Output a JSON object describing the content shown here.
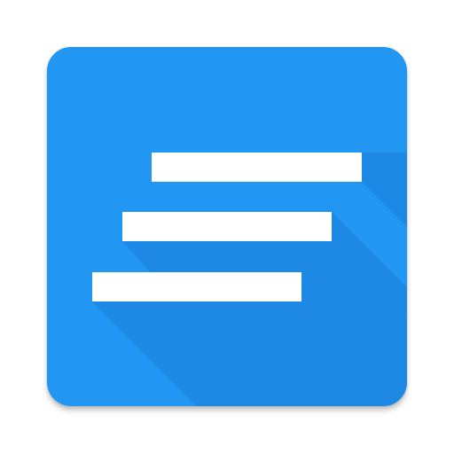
{
  "app_icon": {
    "icon": "lines-icon",
    "colors": {
      "background": "#2196F3",
      "long_shadow": "#1E88E5",
      "bars": "#FFFFFF"
    },
    "bars": [
      {
        "name": "top-bar"
      },
      {
        "name": "middle-bar"
      },
      {
        "name": "bottom-bar"
      }
    ]
  }
}
